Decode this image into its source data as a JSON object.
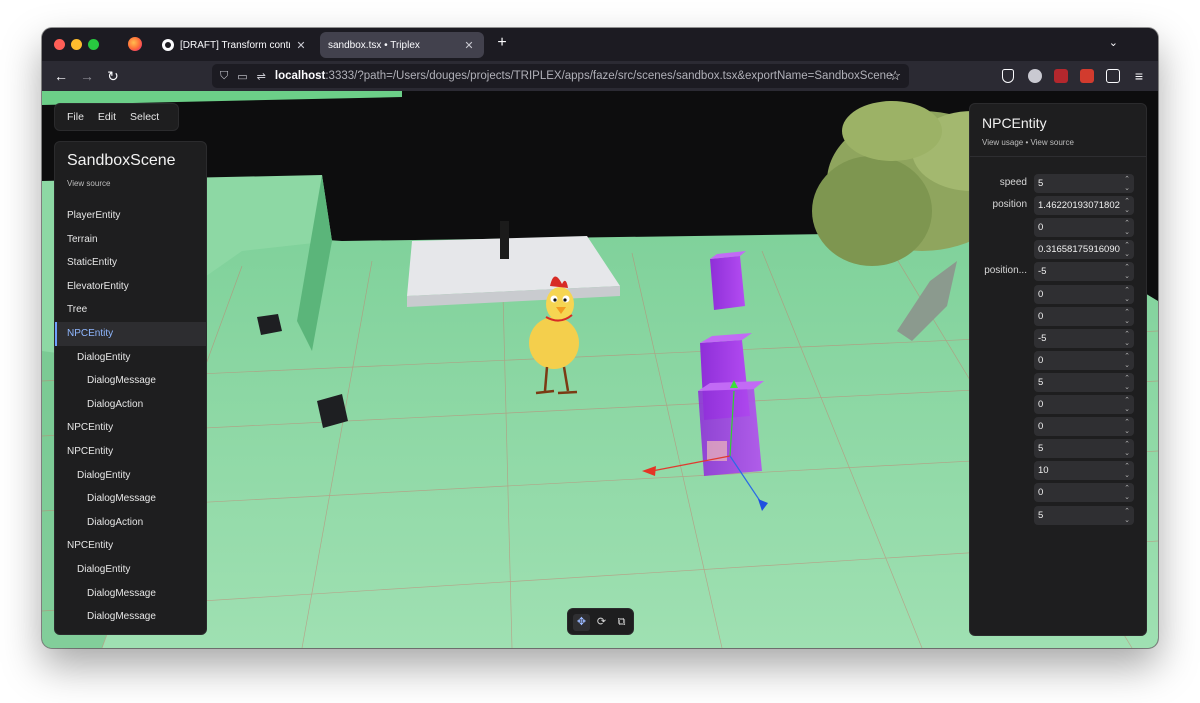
{
  "browser": {
    "tabs": [
      {
        "title": "[DRAFT] Transform controls UI |",
        "close": "✕"
      },
      {
        "title": "sandbox.tsx • Triplex",
        "close": "✕"
      }
    ],
    "new_tab": "+",
    "tab_list": "⌄",
    "url_host": "localhost",
    "url_rest": ":3333/?path=/Users/douges/projects/TRIPLEX/apps/faze/src/scenes/sandbox.tsx&exportName=SandboxScene",
    "nav": {
      "back": "←",
      "forward": "→",
      "reload": "↻",
      "bookmark": "☆",
      "menu": "≡"
    }
  },
  "menubar": {
    "file": "File",
    "edit": "Edit",
    "select": "Select"
  },
  "scene": {
    "title": "SandboxScene",
    "view_source": "View source",
    "items": [
      {
        "label": "PlayerEntity",
        "depth": 0
      },
      {
        "label": "Terrain",
        "depth": 0
      },
      {
        "label": "StaticEntity",
        "depth": 0
      },
      {
        "label": "ElevatorEntity",
        "depth": 0
      },
      {
        "label": "Tree",
        "depth": 0
      },
      {
        "label": "NPCEntity",
        "depth": 0,
        "selected": true
      },
      {
        "label": "DialogEntity",
        "depth": 1
      },
      {
        "label": "DialogMessage",
        "depth": 2
      },
      {
        "label": "DialogAction",
        "depth": 2
      },
      {
        "label": "NPCEntity",
        "depth": 0
      },
      {
        "label": "NPCEntity",
        "depth": 0
      },
      {
        "label": "DialogEntity",
        "depth": 1
      },
      {
        "label": "DialogMessage",
        "depth": 2
      },
      {
        "label": "DialogAction",
        "depth": 2
      },
      {
        "label": "NPCEntity",
        "depth": 0
      },
      {
        "label": "DialogEntity",
        "depth": 1
      },
      {
        "label": "DialogMessage",
        "depth": 2
      },
      {
        "label": "DialogMessage",
        "depth": 2
      }
    ]
  },
  "props": {
    "title": "NPCEntity",
    "links": "View usage • View source",
    "rows": [
      {
        "label": "speed",
        "value": "5"
      },
      {
        "label": "position",
        "value": "1.46220193071802"
      },
      {
        "label": "",
        "value": "0"
      },
      {
        "label": "",
        "value": "0.31658175916090"
      },
      {
        "label": "position...",
        "value": "-5"
      },
      {
        "label": "",
        "value": "0"
      },
      {
        "label": "",
        "value": "0"
      },
      {
        "label": "",
        "value": "-5"
      },
      {
        "label": "",
        "value": "0"
      },
      {
        "label": "",
        "value": "5"
      },
      {
        "label": "",
        "value": "0"
      },
      {
        "label": "",
        "value": "0"
      },
      {
        "label": "",
        "value": "5"
      },
      {
        "label": "",
        "value": "10"
      },
      {
        "label": "",
        "value": "0"
      },
      {
        "label": "",
        "value": "5"
      }
    ]
  },
  "toolbar": {
    "translate": "✥",
    "rotate": "⟳",
    "scale": "⧉"
  },
  "colors": {
    "ground": "#8fd9a3",
    "tab_active": "#42414d",
    "selection": "#8fb7ff"
  }
}
